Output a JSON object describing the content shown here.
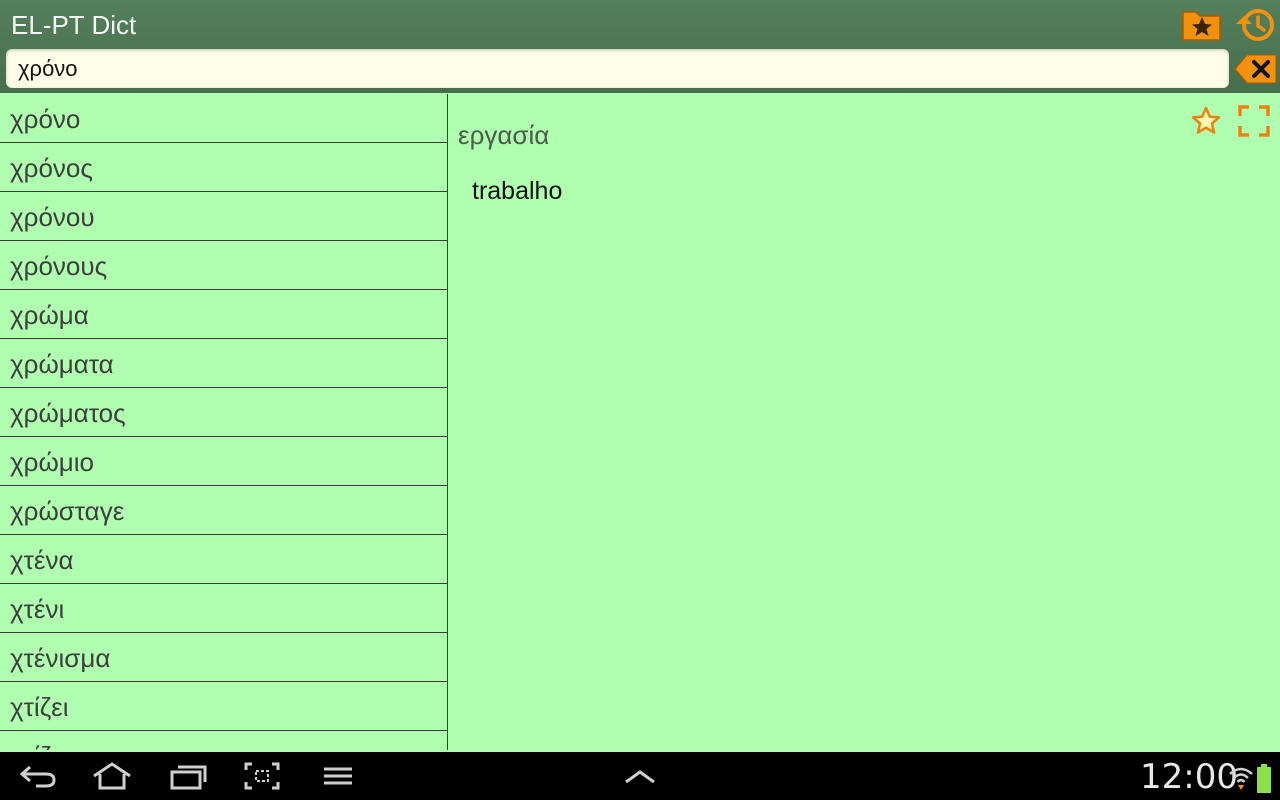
{
  "app": {
    "title": "EL-PT Dict"
  },
  "header": {
    "favorites_icon": "star-folder-icon",
    "history_icon": "history-icon"
  },
  "search": {
    "value": "χρόνο",
    "clear_icon": "backspace-x-icon"
  },
  "word_list": {
    "items": [
      "χρόνο",
      "χρόνος",
      "χρόνου",
      "χρόνους",
      "χρώμα",
      "χρώματα",
      "χρώματος",
      "χρώμιο",
      "χρώσταγε",
      "χτένα",
      "χτένι",
      "χτένισμα",
      "χτίζει",
      "χτίζω"
    ]
  },
  "detail": {
    "headword": "εργασία",
    "translation": "trabalho",
    "favorite_icon": "star-outline-icon",
    "fullscreen_icon": "fullscreen-icon"
  },
  "status_bar": {
    "time": "12:00",
    "nav_icons": [
      "back-icon",
      "home-icon",
      "recent-apps-icon",
      "screenshot-icon",
      "menu-icon",
      "chevron-up-icon"
    ],
    "wifi_icon": "wifi-icon",
    "battery_icon": "battery-icon"
  },
  "colors": {
    "accent": "#ee8a10",
    "header": "#4f7856",
    "background": "#b0ffb0"
  }
}
